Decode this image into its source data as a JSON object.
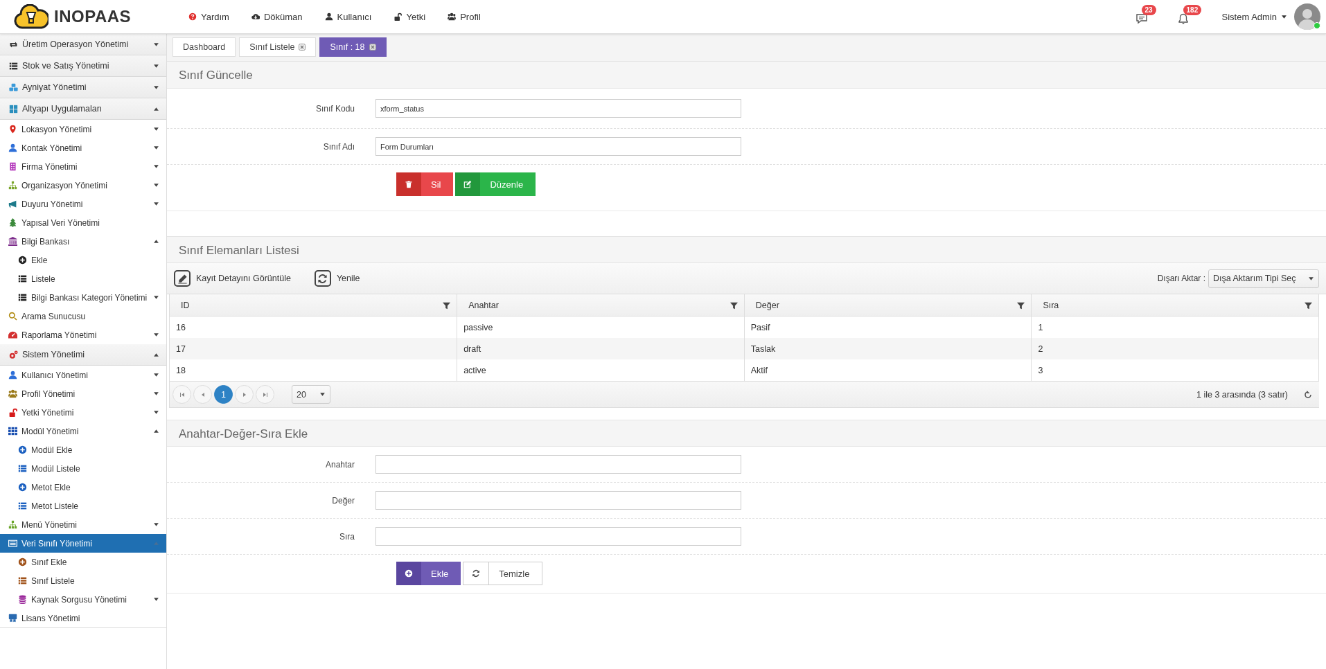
{
  "header": {
    "logo": "INOPAAS",
    "nav": [
      {
        "label": "Yardım"
      },
      {
        "label": "Döküman"
      },
      {
        "label": "Kullanıcı"
      },
      {
        "label": "Yetki"
      },
      {
        "label": "Profil"
      }
    ],
    "messages_badge": "23",
    "notifications_badge": "182",
    "user": "Sistem Admin",
    "online": true
  },
  "sidebar": {
    "items": [
      {
        "label": "Üretim Operasyon Yönetimi",
        "kind": "section",
        "expanded": false,
        "selected": false
      },
      {
        "label": "Stok ve Satış Yönetimi",
        "kind": "section",
        "expanded": false,
        "selected": false
      },
      {
        "label": "Ayniyat Yönetimi",
        "kind": "section",
        "expanded": false,
        "selected": false
      },
      {
        "label": "Altyapı Uygulamaları",
        "kind": "section",
        "expanded": true,
        "selected": false,
        "children": [
          {
            "label": "Lokasyon Yönetimi",
            "kind": "folder",
            "expanded": false,
            "selected": false
          },
          {
            "label": "Kontak Yönetimi",
            "kind": "folder",
            "expanded": false,
            "selected": false
          },
          {
            "label": "Firma Yönetimi",
            "kind": "folder",
            "expanded": false,
            "selected": false
          },
          {
            "label": "Organizasyon Yönetimi",
            "kind": "folder",
            "expanded": false,
            "selected": false
          },
          {
            "label": "Duyuru Yönetimi",
            "kind": "folder",
            "expanded": false,
            "selected": false
          },
          {
            "label": "Yapısal Veri Yönetimi",
            "kind": "link",
            "selected": false
          },
          {
            "label": "Bilgi Bankası",
            "kind": "folder",
            "expanded": true,
            "selected": false,
            "children": [
              {
                "label": "Ekle",
                "kind": "link",
                "selected": false
              },
              {
                "label": "Listele",
                "kind": "link",
                "selected": false
              },
              {
                "label": "Bilgi Bankası Kategori Yönetimi",
                "kind": "folder",
                "expanded": false,
                "selected": false
              }
            ]
          },
          {
            "label": "Arama Sunucusu",
            "kind": "link",
            "selected": false
          },
          {
            "label": "Raporlama Yönetimi",
            "kind": "folder",
            "expanded": false,
            "selected": false
          }
        ]
      },
      {
        "label": "Sistem Yönetimi",
        "kind": "section",
        "expanded": true,
        "selected": false,
        "children": [
          {
            "label": "Kullanıcı Yönetimi",
            "kind": "folder",
            "expanded": false,
            "selected": false
          },
          {
            "label": "Profil Yönetimi",
            "kind": "folder",
            "expanded": false,
            "selected": false
          },
          {
            "label": "Yetki Yönetimi",
            "kind": "folder",
            "expanded": false,
            "selected": false
          },
          {
            "label": "Modül Yönetimi",
            "kind": "folder",
            "expanded": true,
            "selected": false,
            "children": [
              {
                "label": "Modül Ekle",
                "kind": "link",
                "selected": false
              },
              {
                "label": "Modül Listele",
                "kind": "link",
                "selected": false
              },
              {
                "label": "Metot Ekle",
                "kind": "link",
                "selected": false
              },
              {
                "label": "Metot Listele",
                "kind": "link",
                "selected": false
              }
            ]
          },
          {
            "label": "Menü Yönetimi",
            "kind": "folder",
            "expanded": false,
            "selected": false
          },
          {
            "label": "Veri Sınıfı Yönetimi",
            "kind": "folder",
            "expanded": true,
            "selected": true,
            "children": [
              {
                "label": "Sınıf Ekle",
                "kind": "link",
                "selected": false
              },
              {
                "label": "Sınıf Listele",
                "kind": "link",
                "selected": false
              },
              {
                "label": "Kaynak Sorgusu Yönetimi",
                "kind": "folder",
                "expanded": false,
                "selected": false
              }
            ]
          },
          {
            "label": "Lisans Yönetimi",
            "kind": "link",
            "selected": false
          }
        ]
      }
    ]
  },
  "tabs": [
    {
      "label": "Dashboard",
      "closable": false,
      "selected": false
    },
    {
      "label": "Sınıf Listele",
      "closable": true,
      "selected": false
    },
    {
      "label": "Sınıf : 18",
      "closable": true,
      "selected": true
    }
  ],
  "update_form": {
    "title": "Sınıf Güncelle",
    "fields": [
      {
        "label": "Sınıf Kodu",
        "value": "xform_status"
      },
      {
        "label": "Sınıf Adı",
        "value": "Form Durumları"
      }
    ],
    "buttons": [
      {
        "label": "Sil",
        "kind": "delete"
      },
      {
        "label": "Düzenle",
        "kind": "edit"
      }
    ]
  },
  "list_panel": {
    "title": "Sınıf Elemanları Listesi",
    "toolbar": [
      {
        "label": "Kayıt Detayını Görüntüle",
        "kind": "edit"
      },
      {
        "label": "Yenile",
        "kind": "refresh"
      }
    ],
    "export_label": "Dışarı Aktar :",
    "export_select": "Dışa Aktarım Tipi Seç",
    "table": {
      "columns": [
        "ID",
        "Anahtar",
        "Değer",
        "Sıra"
      ],
      "rows": [
        [
          "16",
          "passive",
          "Pasif",
          "1"
        ],
        [
          "17",
          "draft",
          "Taslak",
          "2"
        ],
        [
          "18",
          "active",
          "Aktif",
          "3"
        ]
      ]
    },
    "pager": {
      "pages": [
        {
          "label": "1",
          "selected": true
        }
      ],
      "page_size": "20",
      "summary": "1 ile 3 arasında (3 satır)"
    }
  },
  "add_form": {
    "title": "Anahtar-Değer-Sıra Ekle",
    "fields": [
      {
        "label": "Anahtar"
      },
      {
        "label": "Değer"
      },
      {
        "label": "Sıra"
      }
    ],
    "buttons": [
      {
        "label": "Ekle",
        "kind": "add"
      },
      {
        "label": "Temizle",
        "kind": "clear"
      }
    ]
  }
}
